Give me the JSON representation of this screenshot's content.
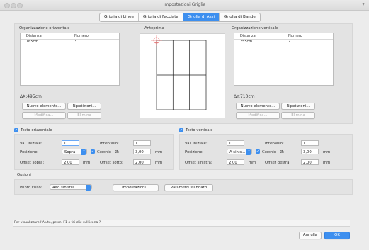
{
  "window": {
    "title": "Impostazioni Griglia",
    "help": "?"
  },
  "tabs": [
    {
      "label": "Griglia di Linee"
    },
    {
      "label": "Griglia di Facciata"
    },
    {
      "label": "Griglia di Assi",
      "active": true
    },
    {
      "label": "Griglia di Bande"
    }
  ],
  "horizontal_org": {
    "title": "Organizzazione orizzontale",
    "columns": [
      "Distanza",
      "Numero"
    ],
    "rows": [
      [
        "165cm",
        "3"
      ]
    ],
    "total": "ΔX:495cm",
    "new_btn": "Nuovo elemento...",
    "repeat_btn": "Ripetizioni...",
    "edit_btn": "Modifica...",
    "delete_btn": "Elimina"
  },
  "preview": {
    "title": "Anteprima"
  },
  "vertical_org": {
    "title": "Organizzazione verticale",
    "columns": [
      "Distanza",
      "Numero"
    ],
    "rows": [
      [
        "355cm",
        "2"
      ]
    ],
    "total": "ΔY:710cm",
    "new_btn": "Nuovo elemento...",
    "repeat_btn": "Ripetizioni...",
    "edit_btn": "Modifica...",
    "delete_btn": "Elimina"
  },
  "text_h": {
    "title": "Testo orizzontale",
    "init_label": "Val. iniziale:",
    "init_value": "1",
    "interval_label": "Intervallo:",
    "interval_value": "1",
    "position_label": "Posizione:",
    "position_value": "Sopra",
    "circle_label": "Cerchio - Ø:",
    "circle_value": "3,00",
    "circle_unit": "mm",
    "offset1_label": "Offset sopra:",
    "offset1_value": "2,00",
    "offset1_unit": "mm",
    "offset2_label": "Offset sotto:",
    "offset2_value": "2,00",
    "offset2_unit": "mm"
  },
  "text_v": {
    "title": "Testo verticale",
    "init_label": "Val. iniziale:",
    "init_value": "1",
    "interval_label": "Intervallo:",
    "interval_value": "1",
    "position_label": "Posizione:",
    "position_value": "A sinis...",
    "circle_label": "Cerchio - Ø:",
    "circle_value": "3,00",
    "circle_unit": "mm",
    "offset1_label": "Offset sinistra:",
    "offset1_value": "2,00",
    "offset1_unit": "mm",
    "offset2_label": "Offset destra:",
    "offset2_value": "2,00",
    "offset2_unit": "mm"
  },
  "options": {
    "title": "Opzioni",
    "fixed_label": "Punto Fisso:",
    "fixed_value": "Alto sinistra",
    "settings_btn": "Impostazioni...",
    "standard_btn": "Parametri standard"
  },
  "status": {
    "hint": "Per visualizzare l'Aiuto, premi F1 o fai clic sull'icona ?"
  },
  "footer": {
    "cancel": "Annulla",
    "ok": "OK"
  },
  "colors": {
    "accent": "#3d8fef",
    "marker": "#e05050"
  }
}
